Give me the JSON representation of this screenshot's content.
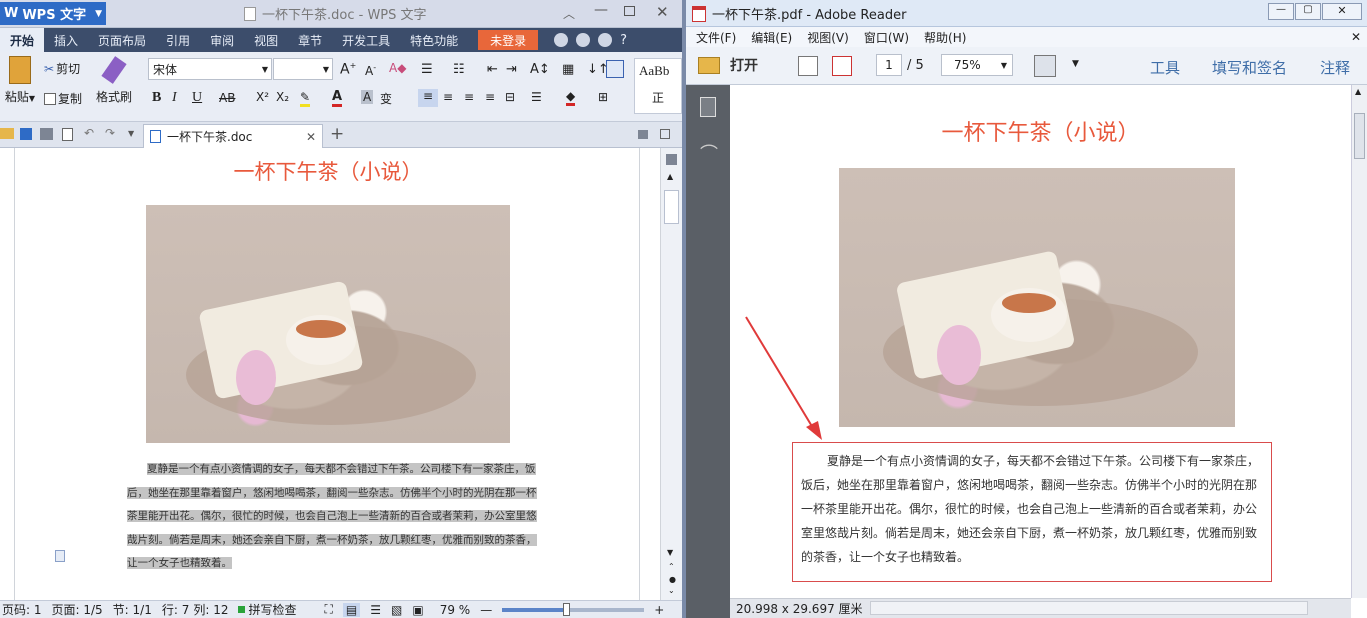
{
  "wps": {
    "app_name": "WPS 文字",
    "window_title": "一杯下午茶.doc - WPS 文字",
    "menu_tabs": [
      "开始",
      "插入",
      "页面布局",
      "引用",
      "审阅",
      "视图",
      "章节",
      "开发工具",
      "特色功能"
    ],
    "login_button": "未登录",
    "clipboard": {
      "paste": "粘贴",
      "cut": "剪切",
      "copy": "复制",
      "format_painter": "格式刷"
    },
    "font_name": "宋体",
    "font_size": "",
    "style_preview": {
      "sample": "AaBb",
      "label": "正"
    },
    "doc_tab": "一杯下午茶.doc",
    "doc_title": "一杯下午茶（小说）",
    "doc_paragraph_lines": [
      "夏静是一个有点小资情调的女子，每天都不会错过下午茶。公司楼下有一家茶庄，饭",
      "后，她坐在那里靠着窗户，悠闲地喝喝茶，翻阅一些杂志。仿佛半个小时的光阴在那一杯",
      "茶里能开出花。偶尔，很忙的时候，也会自己泡上一些清新的百合或者茉莉，办公室里悠",
      "哉片刻。倘若是周末，她还会亲自下厨，煮一杯奶茶，放几颗红枣，优雅而别致的茶香，",
      "让一个女子也精致着。"
    ],
    "status": {
      "page_code": "页码: 1",
      "page": "页面: 1/5",
      "section": "节: 1/1",
      "line": "行: 7",
      "column": "列: 12",
      "spellcheck": "拼写检查",
      "zoom": "79 %",
      "zoom_level": 0.45
    }
  },
  "pdf": {
    "window_title": "一杯下午茶.pdf - Adobe Reader",
    "menu": [
      "文件(F)",
      "编辑(E)",
      "视图(V)",
      "窗口(W)",
      "帮助(H)"
    ],
    "open_label": "打开",
    "page_current": "1",
    "page_total": "/ 5",
    "zoom": "75%",
    "tools": "工具",
    "fill_sign": "填写和签名",
    "comment": "注释",
    "doc_title": "一杯下午茶（小说）",
    "paragraph_lines": [
      "夏静是一个有点小资情调的女子，每天都不会错过下午茶。公司楼下有一家茶庄，",
      "饭后，她坐在那里靠着窗户，悠闲地喝喝茶，翻阅一些杂志。仿佛半个小时的光阴在那",
      "一杯茶里能开出花。偶尔，很忙的时候，也会自己泡上一些清新的百合或者茉莉，办公",
      "室里悠哉片刻。倘若是周末，她还会亲自下厨，煮一杯奶茶，放几颗红枣，优雅而别致",
      "的茶香，让一个女子也精致着。"
    ],
    "page_size": "20.998 x 29.697 厘米"
  },
  "colors": {
    "title_red": "#e8593c",
    "wps_blue": "#2e6bc6",
    "login_orange": "#e8673a",
    "annotation_red": "#e03a3a"
  }
}
